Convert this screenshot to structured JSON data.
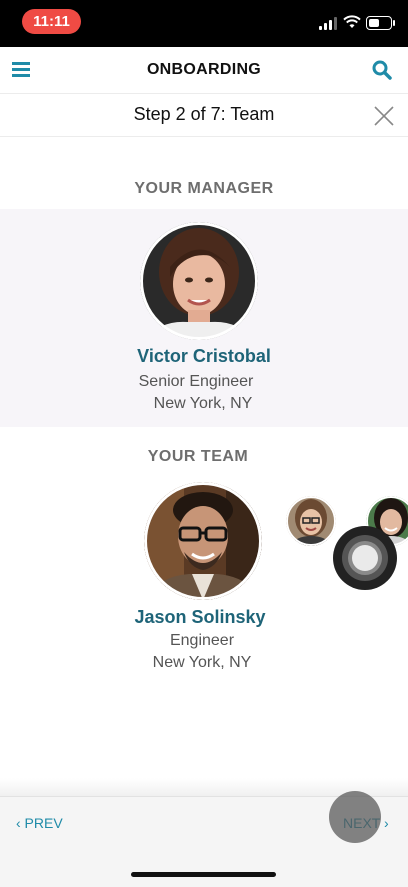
{
  "status_bar": {
    "time": "11:11",
    "battery_level": 0.6
  },
  "header": {
    "title": "ONBOARDING",
    "menu_icon": "hamburger-menu-icon",
    "search_icon": "search-icon"
  },
  "step": {
    "title": "Step 2 of 7: Team",
    "close_icon": "close-icon"
  },
  "manager_section": {
    "heading": "YOUR MANAGER",
    "name": "Victor Cristobal",
    "role": "Senior Engineer",
    "location": "New York, NY"
  },
  "team_section": {
    "heading": "YOUR TEAM",
    "current": {
      "name": "Jason Solinsky",
      "role": "Engineer",
      "location": "New York, NY"
    }
  },
  "nav": {
    "prev_label": "‹ PREV",
    "next_label": "NEXT ›"
  },
  "colors": {
    "accent": "#1f8ba8",
    "name_color": "#1e6478",
    "status_pill": "#ef4b44"
  }
}
